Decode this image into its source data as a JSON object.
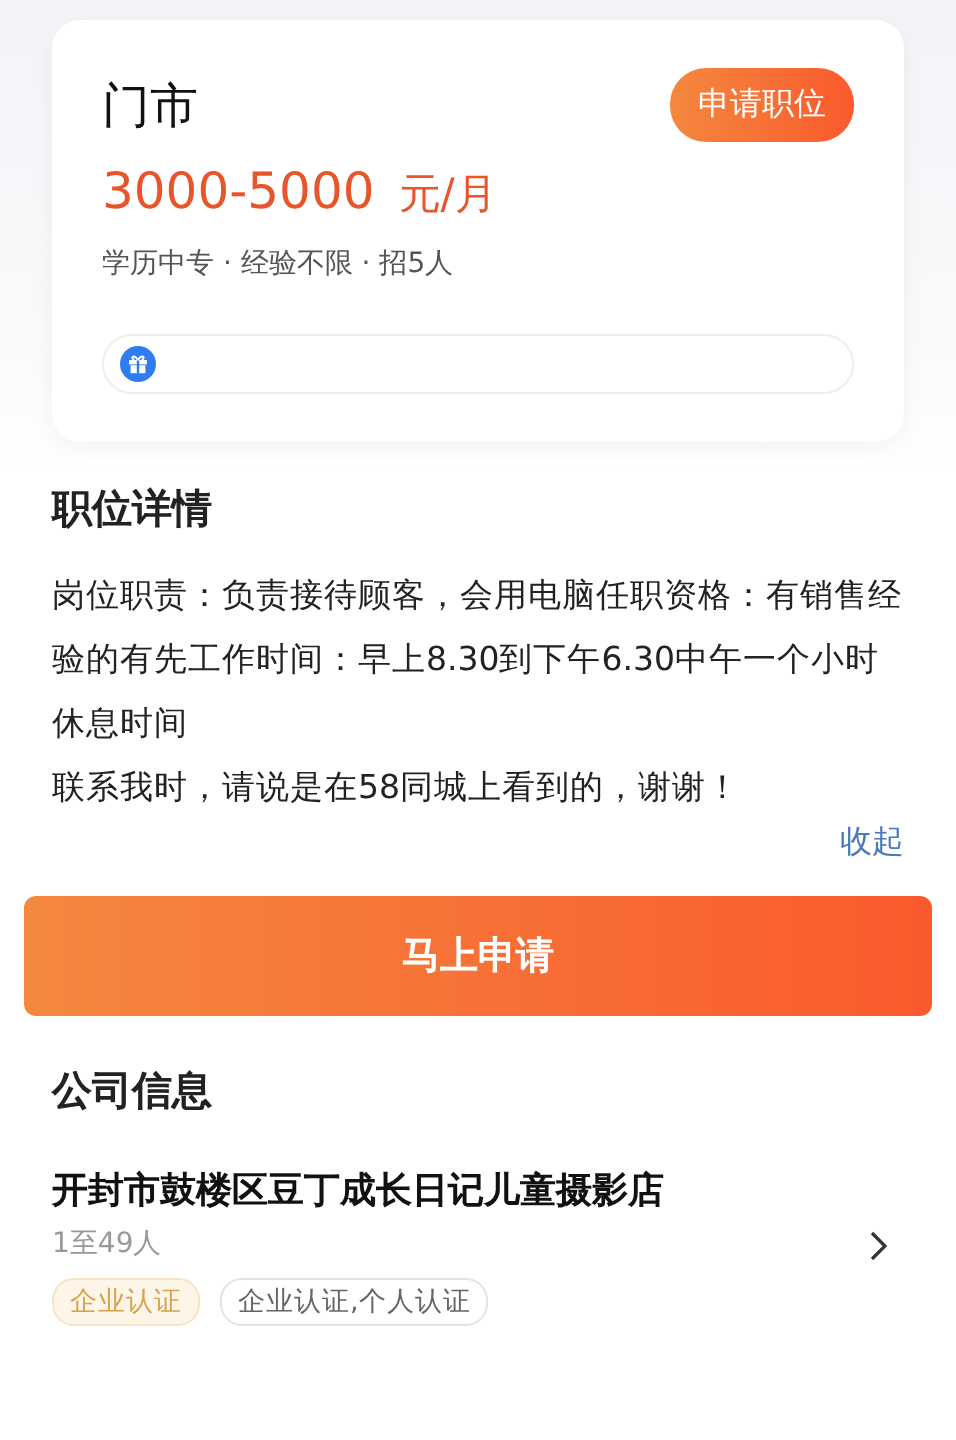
{
  "job": {
    "title": "门市",
    "apply_badge": "申请职位",
    "salary": "3000-5000",
    "salary_unit": "元/月",
    "meta": "学历中专 · 经验不限 · 招5人"
  },
  "details": {
    "heading": "职位详情",
    "paragraphs": [
      "岗位职责：负责接待顾客，会用电脑任职资格：有销售经验的有先工作时间：早上8.30到下午6.30中午一个小时休息时间",
      "联系我时，请说是在58同城上看到的，谢谢！"
    ],
    "collapse_link": "收起"
  },
  "apply_button": "马上申请",
  "company": {
    "heading": "公司信息",
    "name": "开封市鼓楼区豆丁成长日记儿童摄影店",
    "size": "1至49人",
    "tags": [
      {
        "kind": "gold",
        "label": "企业认证"
      },
      {
        "kind": "plain",
        "label": "企业认证,个人认证"
      }
    ]
  }
}
